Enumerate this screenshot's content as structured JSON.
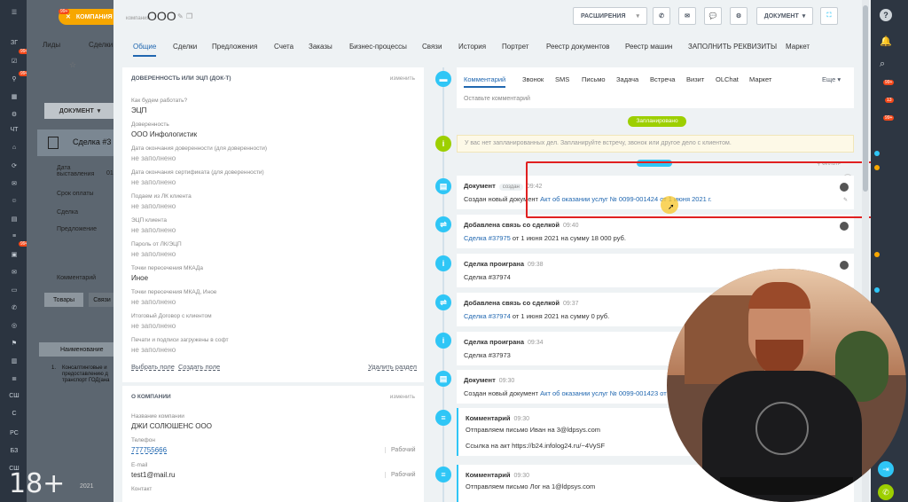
{
  "left_nav": {
    "items": [
      "ЗГ",
      "ЧТ",
      "СШ",
      "С",
      "РС",
      "БЗ",
      "СШ"
    ],
    "badges": [
      "99+",
      "99+",
      "99+"
    ]
  },
  "background": {
    "company_pill": "КОМПАНИЯ",
    "pill_badge": "99+",
    "leads": "Лиды",
    "deals": "Сделки",
    "doc_button": "ДОКУМЕНТ",
    "deal_title": "Сделка #3",
    "fields": [
      "Дата выставления",
      "Срок оплаты",
      "Сделка",
      "Предложение",
      "Комментарий"
    ],
    "field_value": "01.",
    "tab_products": "Товары",
    "tab_links": "Связи",
    "col_name": "Наименование",
    "row_num": "1.",
    "row_text": "Консалтинговые и предоставлению д транспорт ГОД(ана",
    "bottom_date": "2021"
  },
  "header": {
    "company_type_label": "компания",
    "title": "ООО",
    "extensions_button": "РАСШИРЕНИЯ",
    "document_button": "ДОКУМЕНТ"
  },
  "tabs": [
    "Общие",
    "Сделки",
    "Предложения",
    "Счета",
    "Заказы",
    "Бизнес-процессы",
    "Связи",
    "История",
    "Портрет",
    "Реестр документов",
    "Реестр машин",
    "ЗАПОЛНИТЬ РЕКВИЗИТЫ",
    "Маркет"
  ],
  "power_of_attorney": {
    "title": "ДОВЕРЕННОСТЬ ИЛИ ЭЦП (ДОК-Т)",
    "edit": "изменить",
    "fields": [
      {
        "label": "Как будем работать?",
        "value": "ЭЦП"
      },
      {
        "label": "Доверенность",
        "value": "ООО Инфологистик"
      },
      {
        "label": "Дата окончания доверенности (для доверенности)",
        "value": "не заполнено"
      },
      {
        "label": "Дата окончания сертификата (для доверенности)",
        "value": "не заполнено"
      },
      {
        "label": "Подаем из ЛК клиента",
        "value": "не заполнено"
      },
      {
        "label": "ЭЦП клиента",
        "value": "не заполнено"
      },
      {
        "label": "Пароль от ЛК/ЭЦП",
        "value": "не заполнено"
      },
      {
        "label": "Точки пересечения МКАДа",
        "value": "Иное"
      },
      {
        "label": "Точки пересечения МКАД, Иное",
        "value": "не заполнено"
      },
      {
        "label": "Итоговый Договор с клиентом",
        "value": "не заполнено"
      },
      {
        "label": "Печати и подписи загружены в софт",
        "value": "не заполнено"
      }
    ],
    "select_field": "Выбрать поле",
    "create_field": "Создать поле",
    "delete_section": "Удалить раздел"
  },
  "about_company": {
    "title": "О КОМПАНИИ",
    "edit": "изменить",
    "name_label": "Название компании",
    "name_value": "ДЖИ СОЛЮШЕНС ООО",
    "phone_label": "Телефон",
    "phone_value": "777755666",
    "phone_type": "Рабочий",
    "email_label": "E-mail",
    "email_value": "test1@mail.ru",
    "email_type": "Рабочий",
    "contact_label": "Контакт"
  },
  "composer": {
    "tabs": [
      "Комментарий",
      "Звонок",
      "SMS",
      "Письмо",
      "Задача",
      "Встреча",
      "Визит",
      "OLChat",
      "Маркет"
    ],
    "more": "Еще",
    "placeholder": "Оставьте комментарий"
  },
  "timeline": {
    "planned_label": "Запланировано",
    "no_plans": "У вас нет запланированных дел. Запланируйте встречу, звонок или другое дело с клиентом.",
    "filter": "ФИЛЬТР",
    "events": [
      {
        "title": "Документ",
        "tag": "создан",
        "time": "09:42",
        "text": "Создан новый документ ",
        "link": "Акт об оказании услуг № 0099-001424 от 1 июня 2021 г.",
        "icon": "doc"
      },
      {
        "title": "Добавлена связь со сделкой",
        "tag": "",
        "time": "09:40",
        "text": "",
        "link": "Сделка #37975",
        "after": " от 1 июня 2021 на сумму 18 000 руб.",
        "icon": "link"
      },
      {
        "title": "Сделка проиграна",
        "tag": "",
        "time": "09:38",
        "text": "Сделка #37974",
        "link": "",
        "icon": "info"
      },
      {
        "title": "Добавлена связь со сделкой",
        "tag": "",
        "time": "09:37",
        "text": "",
        "link": "Сделка #37974",
        "after": " от 1 июня 2021 на сумму 0 руб.",
        "icon": "link"
      },
      {
        "title": "Сделка проиграна",
        "tag": "",
        "time": "09:34",
        "text": "Сделка #37973",
        "link": "",
        "icon": "info"
      },
      {
        "title": "Документ",
        "tag": "",
        "time": "09:30",
        "text": "Создан новый документ ",
        "link": "Акт об оказании услуг № 0099-001423 от 1 июня 2021 г.",
        "icon": "doc"
      },
      {
        "title": "Комментарий",
        "tag": "",
        "time": "09:30",
        "text": "Отправляем письмо Иван на 3@ldpsys.com",
        "link": "",
        "line2": "Ссылка на акт https://b24.infolog24.ru/~4VySF",
        "icon": "comment"
      },
      {
        "title": "Комментарий",
        "tag": "",
        "time": "09:30",
        "text": "Отправляем письмо Лог на 1@ldpsys.com",
        "link": "",
        "icon": "comment"
      }
    ]
  },
  "right_bar": {
    "badges": [
      "99+",
      "13",
      "99+"
    ]
  },
  "overlay": {
    "age_rating": "18+"
  },
  "colors": {
    "accent_blue": "#2fc6f6",
    "planned_green": "#9dcf00",
    "info_green": "#9dcf00",
    "highlight_red": "#e02020",
    "badge_red": "#f54819",
    "company_pill": "#f7a700"
  }
}
